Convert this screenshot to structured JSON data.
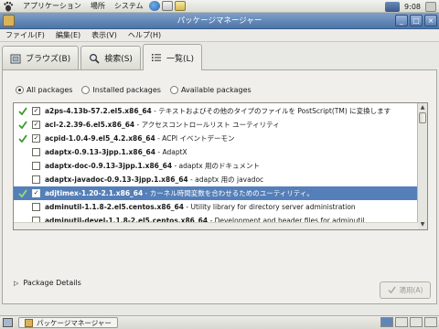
{
  "top_panel": {
    "menus": [
      "アプリケーション",
      "場所",
      "システム"
    ],
    "clock": "9:08"
  },
  "window": {
    "title": "パッケージマネージャー"
  },
  "menubar": [
    "ファイル(F)",
    "編集(E)",
    "表示(V)",
    "ヘルプ(H)"
  ],
  "tabs": [
    {
      "label": "ブラウズ(B)",
      "icon": "browse-icon"
    },
    {
      "label": "検索(S)",
      "icon": "search-icon"
    },
    {
      "label": "一覧(L)",
      "icon": "list-icon"
    }
  ],
  "filter": {
    "options": [
      "All packages",
      "Installed packages",
      "Available packages"
    ],
    "selected": "All packages"
  },
  "packages": [
    {
      "name": "a2ps-4.13b-57.2.el5.x86_64",
      "desc": "- テキストおよびその他のタイプのファイルを PostScript(TM) に変換します",
      "installed": true,
      "checked": true,
      "selected": false
    },
    {
      "name": "acl-2.2.39-6.el5.x86_64",
      "desc": "- アクセスコントロールリスト ユーティリティ",
      "installed": true,
      "checked": true,
      "selected": false
    },
    {
      "name": "acpid-1.0.4-9.el5_4.2.x86_64",
      "desc": "- ACPI イベントデーモン",
      "installed": true,
      "checked": true,
      "selected": false
    },
    {
      "name": "adaptx-0.9.13-3jpp.1.x86_64",
      "desc": "- AdaptX",
      "installed": false,
      "checked": false,
      "selected": false
    },
    {
      "name": "adaptx-doc-0.9.13-3jpp.1.x86_64",
      "desc": "- adaptx 用のドキュメント",
      "installed": false,
      "checked": false,
      "selected": false
    },
    {
      "name": "adaptx-javadoc-0.9.13-3jpp.1.x86_64",
      "desc": "- adaptx 用の javadoc",
      "installed": false,
      "checked": false,
      "selected": false
    },
    {
      "name": "adjtimex-1.20-2.1.x86_64",
      "desc": "- カーネル時間変数を合わせるためのユーティリティ。",
      "installed": true,
      "checked": true,
      "selected": true
    },
    {
      "name": "adminutil-1.1.8-2.el5.centos.x86_64",
      "desc": "- Utility library for directory server administration",
      "installed": false,
      "checked": false,
      "selected": false
    },
    {
      "name": "adminutil-devel-1.1.8-2.el5.centos.x86_64",
      "desc": "- Development and header files for adminutil",
      "installed": false,
      "checked": false,
      "selected": false
    }
  ],
  "details_label": "Package Details",
  "apply_label": "適用(A)",
  "taskbar": {
    "task_label": "パッケージマネージャー"
  },
  "colors": {
    "selection": "#557fb8",
    "titlebar": "#4d74a8"
  }
}
